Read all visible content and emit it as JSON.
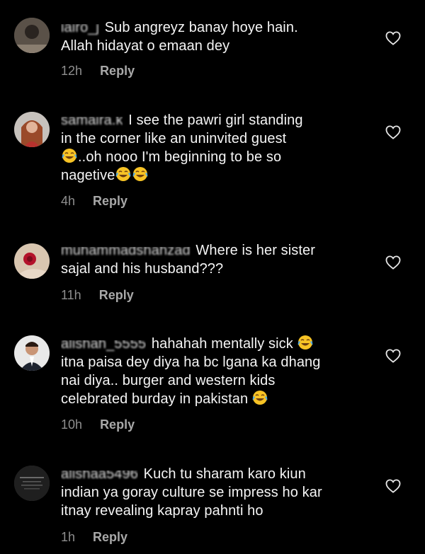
{
  "colors": {
    "background": "#000000",
    "text": "#f5f5f5",
    "muted": "#8e8e8e"
  },
  "comments": [
    {
      "username": "iairo_j",
      "text_lines": [
        "Sub angreyz banay hoye hain.",
        "Allah hidayat o emaan dey"
      ],
      "time": "12h",
      "reply_label": "Reply",
      "like_icon": "heart-outline-icon"
    },
    {
      "username": "samaira.k",
      "line1": "I see the pawri girl standing",
      "line2": "in the corner like an uninvited guest",
      "line3_after_emoji": "..oh nooo I'm beginning to be so",
      "line4": "nagetive",
      "emoji": "face-with-tears-of-joy",
      "time": "4h",
      "reply_label": "Reply",
      "like_icon": "heart-outline-icon"
    },
    {
      "username": "muhammadshahzad",
      "text_lines": [
        "Where is her sister",
        "sajal and his husband???"
      ],
      "time": "11h",
      "reply_label": "Reply",
      "like_icon": "heart-outline-icon"
    },
    {
      "username": "alishah_5555",
      "line1": "hahahah mentally sick",
      "line2": "itna paisa dey diya ha bc lgana ka dhang",
      "line3": "nai diya.. burger and western kids",
      "line4": "celebrated burday in pakistan",
      "emoji": "face-with-tears-of-joy",
      "time": "10h",
      "reply_label": "Reply",
      "like_icon": "heart-outline-icon"
    },
    {
      "username": "alishaa5496",
      "text_lines": [
        "Kuch tu sharam karo kiun",
        "indian ya goray culture se impress ho kar",
        "itnay revealing kapray pahnti ho"
      ],
      "time": "1h",
      "reply_label": "Reply",
      "like_icon": "heart-outline-icon"
    }
  ]
}
